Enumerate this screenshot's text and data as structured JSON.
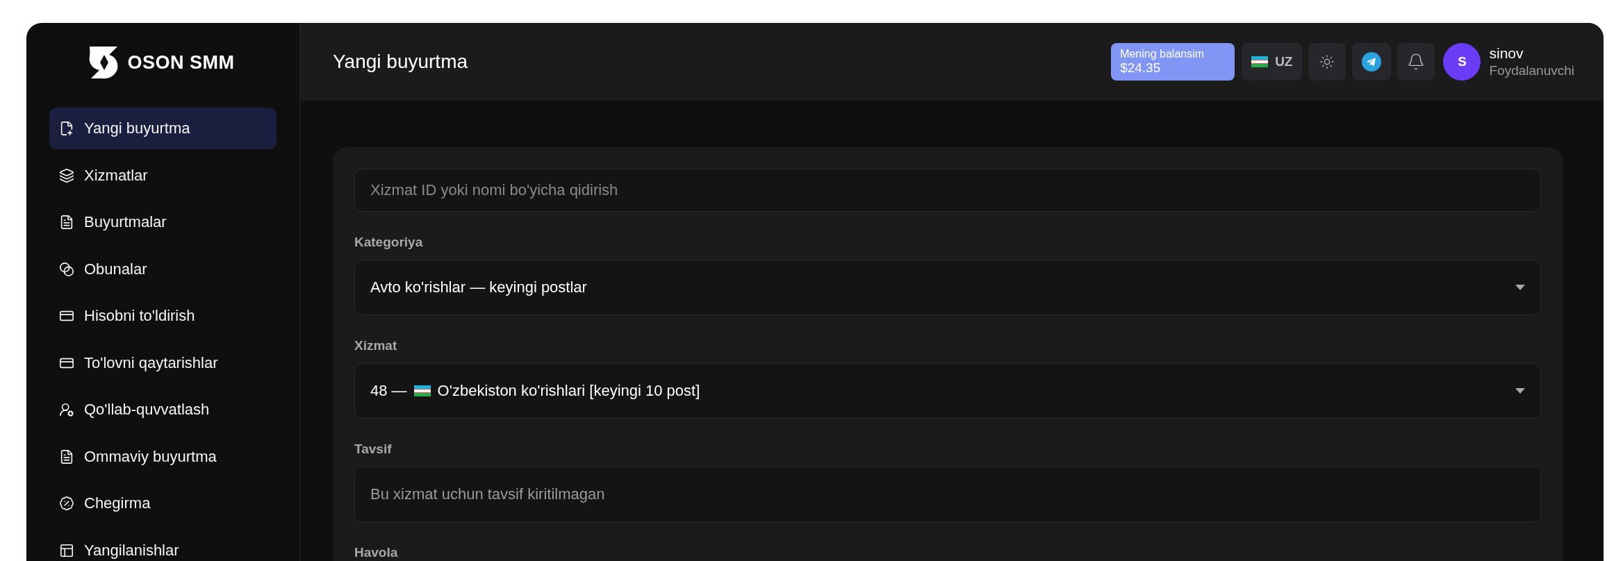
{
  "brand": {
    "name": "OSON SMM"
  },
  "sidebar": {
    "items": [
      {
        "label": "Yangi buyurtma",
        "selected": true
      },
      {
        "label": "Xizmatlar",
        "selected": false
      },
      {
        "label": "Buyurtmalar",
        "selected": false
      },
      {
        "label": "Obunalar",
        "selected": false
      },
      {
        "label": "Hisobni to'ldirish",
        "selected": false
      },
      {
        "label": "To'lovni qaytarishlar",
        "selected": false
      },
      {
        "label": "Qo'llab-quvvatlash",
        "selected": false
      },
      {
        "label": "Ommaviy buyurtma",
        "selected": false
      },
      {
        "label": "Chegirma",
        "selected": false
      },
      {
        "label": "Yangilanishlar",
        "selected": false
      }
    ]
  },
  "header": {
    "title": "Yangi buyurtma",
    "balance": {
      "label": "Mening balansim",
      "amount": "$24.35"
    },
    "language": "UZ",
    "user": {
      "initial": "S",
      "name": "sinov",
      "role": "Foydalanuvchi"
    }
  },
  "form": {
    "search": {
      "placeholder": "Xizmat ID yoki nomi bo'yicha qidirish"
    },
    "fields": [
      {
        "kind": "select",
        "label": "Kategoriya",
        "value": "Avto ko'rishlar — keyingi postlar"
      },
      {
        "kind": "select",
        "label": "Xizmat",
        "prefix": "48 —",
        "value": "O'zbekiston ko'rishlari [keyingi 10 post]"
      },
      {
        "kind": "text",
        "label": "Tavsif",
        "value": "Bu xizmat uchun tavsif kiritilmagan"
      },
      {
        "kind": "heading",
        "label": "Havola"
      }
    ]
  }
}
